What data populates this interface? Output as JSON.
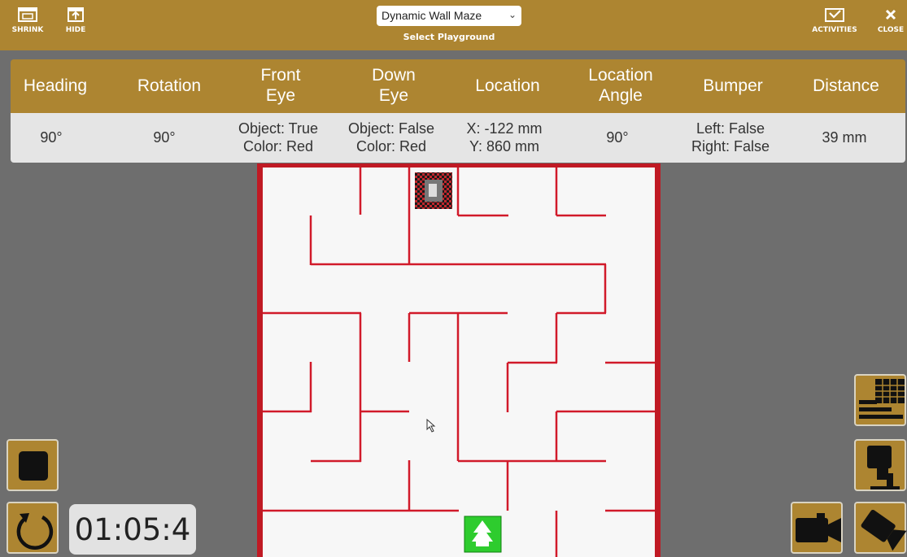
{
  "toolbar": {
    "shrink_label": "SHRINK",
    "hide_label": "HIDE",
    "activities_label": "ACTIVITIES",
    "close_label": "CLOSE"
  },
  "playground": {
    "selected": "Dynamic Wall Maze",
    "caption": "Select Playground"
  },
  "sensors": {
    "headers": [
      "Heading",
      "Rotation",
      "Front\nEye",
      "Down\nEye",
      "Location",
      "Location\nAngle",
      "Bumper",
      "Distance"
    ],
    "values": [
      "90°",
      "90°",
      "Object: True\nColor: Red",
      "Object: False\nColor: Red",
      "X: -122 mm\nY: 860 mm",
      "90°",
      "Left: False\nRight: False",
      "39 mm"
    ]
  },
  "timer": {
    "value": "01:05:4"
  },
  "colors": {
    "bar": "#ad8531",
    "wall": "#d11a2a",
    "maze_floor": "#f7f7f7",
    "robot_green": "#2ecc2e"
  },
  "icons": {
    "shrink": "shrink-icon",
    "hide": "hide-icon",
    "activities": "activities-icon",
    "close": "close-icon",
    "stop": "stop-icon",
    "reset": "reset-icon",
    "data_table": "data-table-icon",
    "camera_top": "top-camera-icon",
    "camera_follow": "follow-camera-icon",
    "camera_side": "side-camera-icon"
  }
}
